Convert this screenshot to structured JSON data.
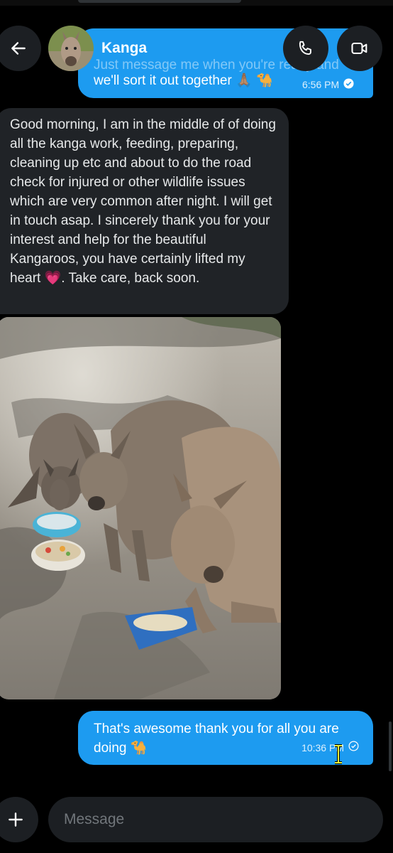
{
  "header": {
    "contact_name": "Kanga"
  },
  "messages": {
    "prev_partial_line": "Just message me when you're ready and",
    "prev_line": "we'll sort it out together 🙏🏽 🐪",
    "prev_time": "6:56 PM",
    "incoming_text": "Good morning, I am in the middle of of doing all the kanga work, feeding, preparing, cleaning up etc and about to do the road check for injured or other wildlife issues which are very common after night. I will get in touch asap. I sincerely thank you for your interest and help for the beautiful Kangaroos, you have certainly lifted my heart 💗. Take care, back soon.",
    "outgoing_text": "That's awesome thank you for all you are doing 🐪",
    "outgoing_time": "10:36 PM"
  },
  "composer": {
    "placeholder": "Message"
  },
  "colors": {
    "accent": "#1d9bf0",
    "incoming_bubble": "#202327",
    "background": "#000000"
  }
}
